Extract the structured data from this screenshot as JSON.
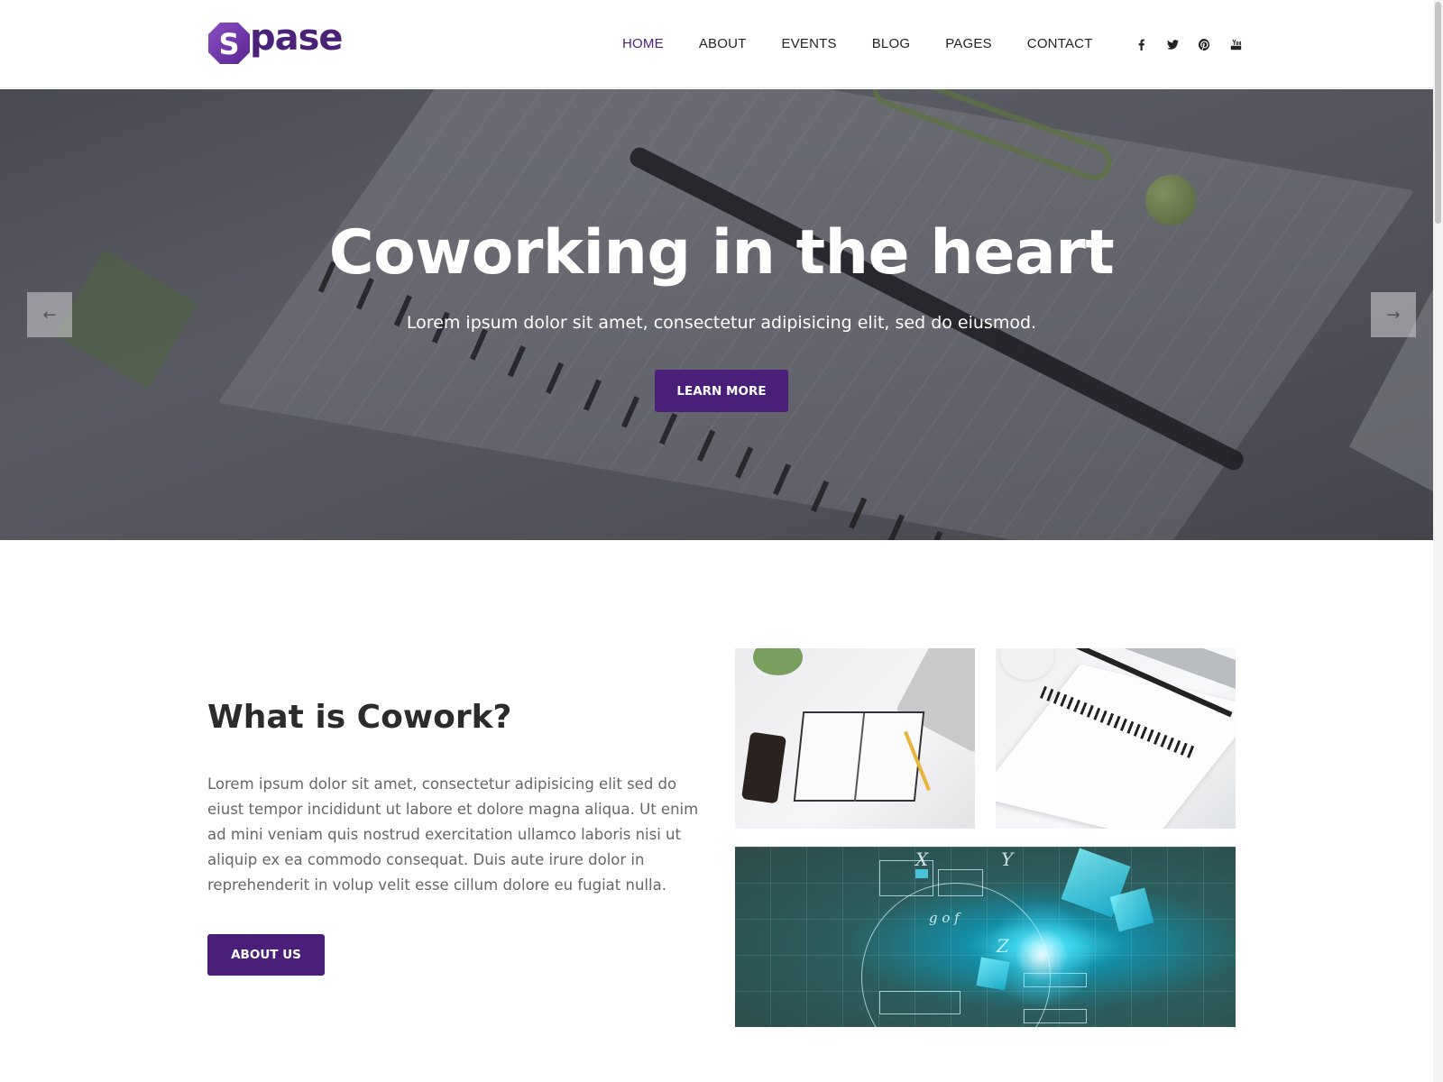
{
  "brand": {
    "logo_letter": "S",
    "logo_text": "pase",
    "color": "#4a2278"
  },
  "nav": {
    "items": [
      {
        "label": "HOME",
        "active": true
      },
      {
        "label": "ABOUT",
        "active": false
      },
      {
        "label": "EVENTS",
        "active": false
      },
      {
        "label": "BLOG",
        "active": false
      },
      {
        "label": "PAGES",
        "active": false
      },
      {
        "label": "CONTACT",
        "active": false
      }
    ]
  },
  "social": [
    "facebook-icon",
    "twitter-icon",
    "pinterest-icon",
    "youtube-icon"
  ],
  "hero": {
    "title": "Coworking in the heart",
    "subtitle": "Lorem ipsum dolor sit amet, consectetur adipisicing elit, sed do eiusmod.",
    "button_label": "LEARN MORE",
    "prev_arrow": "←",
    "next_arrow": "→"
  },
  "about": {
    "title": "What is Cowork?",
    "text": "Lorem ipsum dolor sit amet, consectetur adipisicing elit sed do eiust tempor incididunt ut labore et dolore magna aliqua. Ut enim ad mini veniam quis nostrud exercitation ullamco laboris nisi ut aliquip ex ea commodo consequat. Duis aute irure dolor in reprehenderit in volup velit esse cillum dolore eu fugiat nulla.",
    "button_label": "ABOUT US"
  },
  "colors": {
    "accent": "#4a1f7a",
    "nav_active": "#4a2278",
    "heading": "#2b2b2b",
    "body_text": "#666666"
  }
}
